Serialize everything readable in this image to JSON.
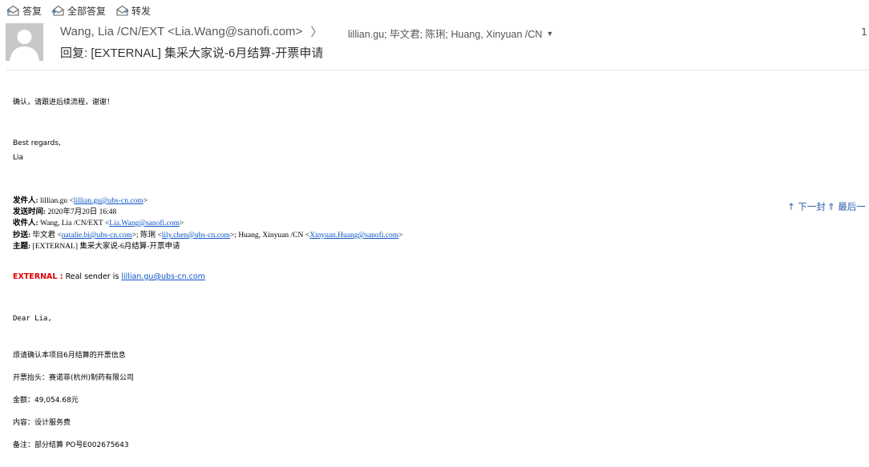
{
  "toolbar": {
    "reply_label": "答复",
    "reply_all_label": "全部答复",
    "forward_label": "转发"
  },
  "header": {
    "from": "Wang, Lia /CN/EXT <Lia.Wang@sanofi.com>",
    "chevron": "〉",
    "recipients": "lillian.gu; 毕文君; 陈琍; Huang, Xinyuan /CN",
    "time_partial": "1",
    "subject": "回复: [EXTERNAL] 集采大家说-6月结算-开票申请"
  },
  "body": {
    "greeting_line": "确认，请跟进后续流程，谢谢！",
    "regards": "Best regards,",
    "signature": "Lia",
    "quoted": {
      "from_label": "发件人:",
      "from_name": "lillian.gu <",
      "from_email": "lillian.gu@ubs-cn.com",
      "from_close": ">",
      "sent_label": "发送时间:",
      "sent_value": "2020年7月20日 16:48",
      "to_label": "收件人:",
      "to_name": "Wang, Lia /CN/EXT <",
      "to_email": "Lia.Wang@sanofi.com",
      "to_close": ">",
      "cc_label": "抄送:",
      "cc_name1": "毕文君 <",
      "cc_email1": "natalie.bi@ubs-cn.com",
      "cc_sep1": ">; 陈琍 <",
      "cc_email2": "lily.chen@ubs-cn.com",
      "cc_sep2": ">; Huang, Xinyuan /CN <",
      "cc_email3": "Xinyuan.Huang@sanofi.com",
      "cc_close": ">",
      "subject_label": "主题:",
      "subject_value": "[EXTERNAL] 集采大家说-6月结算-开票申请"
    },
    "external_label": "EXTERNAL :",
    "external_text": "Real sender is",
    "external_email": "lillian.gu@ubs-cn.com",
    "dear": "Dear Lia,",
    "request_line": "烦请确认本项目6月结算的开票信息",
    "invoice_title": "开票抬头：赛诺菲(杭州)制药有限公司",
    "amount": "金额：49,054.68元",
    "content": "内容：设计服务费",
    "remark": "备注：部分结算 PO号E002675643"
  },
  "nav": {
    "prev_label": "↑ 下一封",
    "last_label": "⇑ 最后一"
  }
}
